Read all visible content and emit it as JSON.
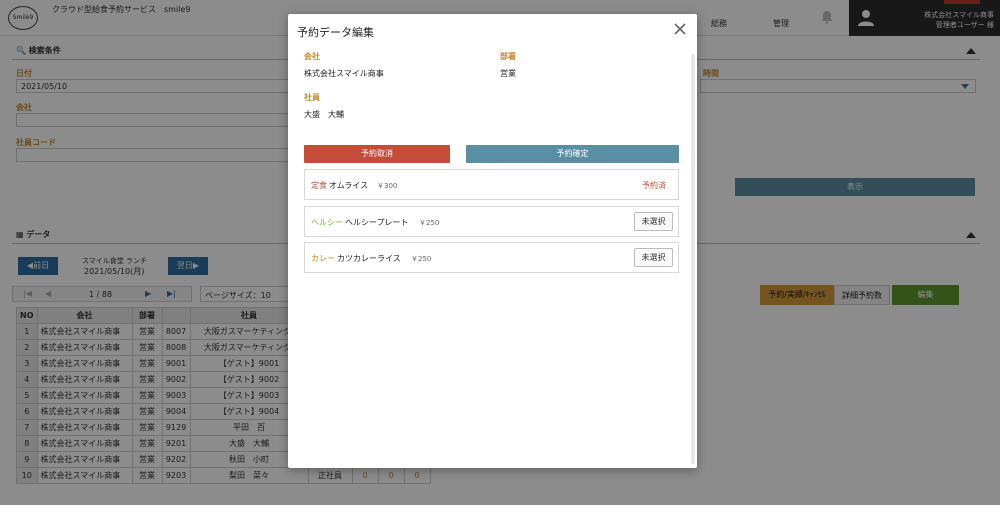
{
  "app": {
    "logo_text": "Smile9",
    "title": "クラウド型給食予約サービス　smile9",
    "nav": [
      "総務",
      "管理"
    ],
    "user_company": "株式会社スマイル商事",
    "user_name": "管理者ユーザー 様"
  },
  "search": {
    "header": "検索条件",
    "date_label": "日付",
    "date_value": "2021/05/10",
    "company_label": "会社",
    "employee_code_label": "社員コード",
    "time_label_partial": "時間",
    "show_button": "表示"
  },
  "data_section": {
    "header": "データ",
    "prev_day": "◀前日",
    "next_day": "翌日▶",
    "meal_label": "スマイル食堂 ランチ",
    "meal_date": "2021/05/10(月)",
    "pager_text": "1 / 88",
    "page_size": "ページサイズ：10",
    "btn_reserve": "予約/実績/ｷｬﾝｾﾙ",
    "btn_detail": "詳細予約数",
    "btn_edit": "編集",
    "columns": [
      "NO",
      "会社",
      "部署",
      "",
      "社員",
      "",
      "",
      "",
      ""
    ],
    "rows": [
      {
        "no": "1",
        "company": "株式会社スマイル商事",
        "dept": "営業",
        "code": "8007",
        "name": "大阪ガスマーケティング(",
        "type": "",
        "a": "",
        "b": "",
        "c": ""
      },
      {
        "no": "2",
        "company": "株式会社スマイル商事",
        "dept": "営業",
        "code": "8008",
        "name": "大阪ガスマーケティング(",
        "type": "",
        "a": "",
        "b": "",
        "c": ""
      },
      {
        "no": "3",
        "company": "株式会社スマイル商事",
        "dept": "営業",
        "code": "9001",
        "name": "【ゲスト】9001",
        "type": "",
        "a": "",
        "b": "",
        "c": ""
      },
      {
        "no": "4",
        "company": "株式会社スマイル商事",
        "dept": "営業",
        "code": "9002",
        "name": "【ゲスト】9002",
        "type": "",
        "a": "",
        "b": "",
        "c": ""
      },
      {
        "no": "5",
        "company": "株式会社スマイル商事",
        "dept": "営業",
        "code": "9003",
        "name": "【ゲスト】9003",
        "type": "",
        "a": "",
        "b": "",
        "c": ""
      },
      {
        "no": "6",
        "company": "株式会社スマイル商事",
        "dept": "営業",
        "code": "9004",
        "name": "【ゲスト】9004",
        "type": "",
        "a": "",
        "b": "",
        "c": ""
      },
      {
        "no": "7",
        "company": "株式会社スマイル商事",
        "dept": "営業",
        "code": "9129",
        "name": "平田　百",
        "type": "",
        "a": "",
        "b": "",
        "c": ""
      },
      {
        "no": "8",
        "company": "株式会社スマイル商事",
        "dept": "営業",
        "code": "9201",
        "name": "大盛　大輔",
        "type": "",
        "a": "",
        "b": "",
        "c": ""
      },
      {
        "no": "9",
        "company": "株式会社スマイル商事",
        "dept": "営業",
        "code": "9202",
        "name": "秋田　小町",
        "type": "",
        "a": "",
        "b": "",
        "c": ""
      },
      {
        "no": "10",
        "company": "株式会社スマイル商事",
        "dept": "営業",
        "code": "9203",
        "name": "梨田　菜々",
        "type": "正社員",
        "a": "0",
        "b": "0",
        "c": "0"
      }
    ]
  },
  "modal": {
    "title": "予約データ編集",
    "company_label": "会社",
    "company_value": "株式会社スマイル商事",
    "dept_label": "部署",
    "dept_value": "営業",
    "employee_label": "社員",
    "employee_value": "大盛　大輔",
    "cancel_button": "予約取消",
    "confirm_button": "予約確定",
    "menus": [
      {
        "category": "定食",
        "category_color": "#c44d3a",
        "name": "オムライス",
        "price": "￥300",
        "status": "予約済",
        "button": ""
      },
      {
        "category": "ヘルシー",
        "category_color": "#7bb32e",
        "name": "ヘルシープレート",
        "price": "￥250",
        "status": "",
        "button": "未選択"
      },
      {
        "category": "カレー",
        "category_color": "#d68a1a",
        "name": "カツカレーライス",
        "price": "￥250",
        "status": "",
        "button": "未選択"
      }
    ]
  },
  "colors": {
    "accent_label": "#c58a2c",
    "cancel": "#c44d3a",
    "confirm": "#5a8ea3",
    "nav_blue": "#2f6fa2",
    "edit_green": "#5c9a2e",
    "reserve_orange": "#d6993a"
  }
}
